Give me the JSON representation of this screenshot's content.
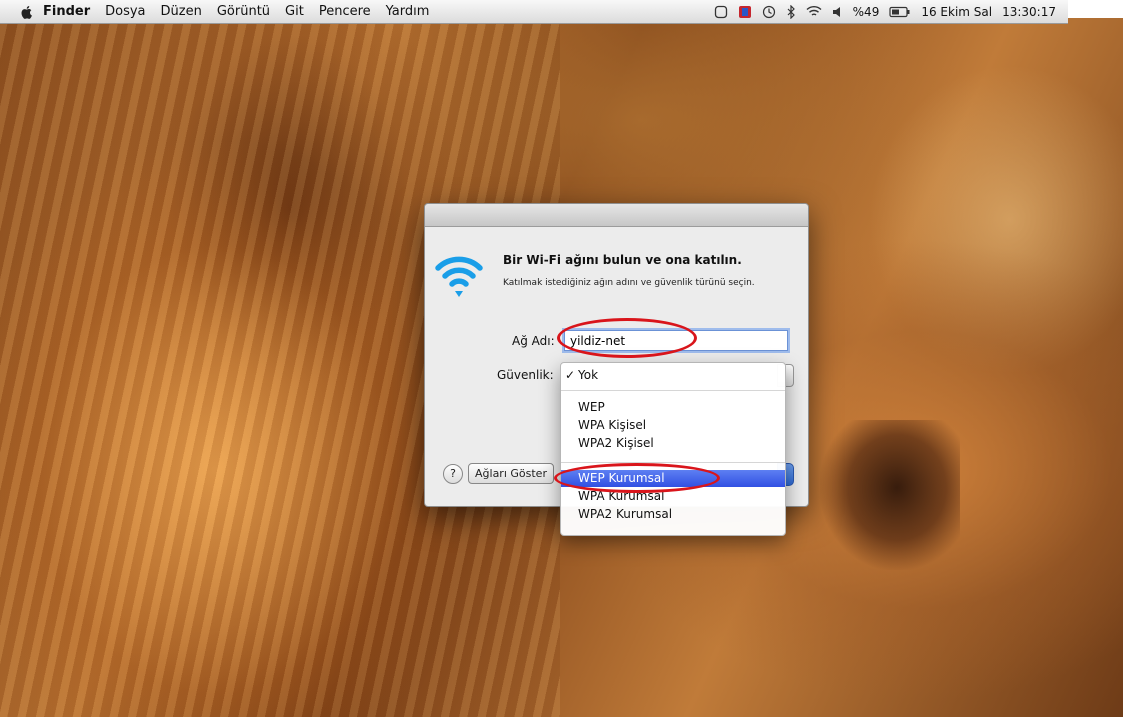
{
  "menubar": {
    "items": [
      "Finder",
      "Dosya",
      "Düzen",
      "Görüntü",
      "Git",
      "Pencere",
      "Yardım"
    ],
    "status_icons": [
      "time-machine-icon",
      "vpn-icon",
      "clock-icon",
      "bluetooth-icon",
      "wifi-icon",
      "volume-icon",
      "battery-icon"
    ],
    "battery": "%49",
    "date": "16 Ekim Sal",
    "time": "13:30:17"
  },
  "dialog": {
    "title": "Bir Wi-Fi ağını bulun ve ona katılın.",
    "subtitle": "Katılmak istediğiniz ağın adını ve güvenlik türünü seçin.",
    "network_name_label": "Ağ Adı:",
    "network_name_value": "yildiz-net",
    "security_label": "Güvenlik:",
    "help_label": "?",
    "show_networks_label": "Ağları Göster"
  },
  "security_menu": {
    "options": [
      {
        "label": "Yok",
        "checked": true,
        "selected": false
      },
      {
        "label": "WEP",
        "checked": false,
        "selected": false
      },
      {
        "label": "WPA Kişisel",
        "checked": false,
        "selected": false
      },
      {
        "label": "WPA2 Kişisel",
        "checked": false,
        "selected": false
      },
      {
        "label": "WEP Kurumsal",
        "checked": false,
        "selected": true
      },
      {
        "label": "WPA Kurumsal",
        "checked": false,
        "selected": false
      },
      {
        "label": "WPA2 Kurumsal",
        "checked": false,
        "selected": false
      }
    ],
    "check_mark": "✓"
  },
  "colors": {
    "annotation": "#d9151b",
    "selection": "#3150e3",
    "wifi_icon": "#1a9ee8"
  }
}
